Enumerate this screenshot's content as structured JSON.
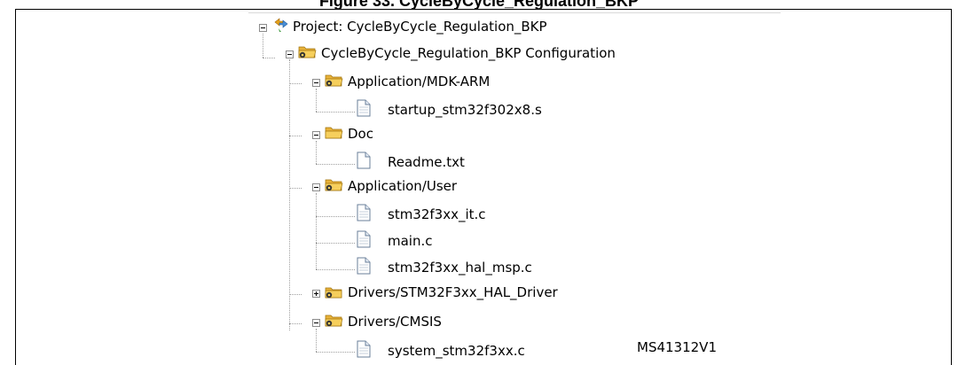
{
  "figure_title": "Figure 33. CycleByCycle_Regulation_BKP",
  "tree": [
    {
      "id": "project",
      "label": "Project: CycleByCycle_Regulation_BKP",
      "type": "project",
      "expanded": true
    },
    {
      "id": "config",
      "label": "CycleByCycle_Regulation_BKP Configuration",
      "type": "config-folder",
      "expanded": true
    },
    {
      "id": "app-mdk",
      "label": "Application/MDK-ARM",
      "type": "group-folder",
      "expanded": true
    },
    {
      "id": "startup",
      "label": "startup_stm32f302x8.s",
      "type": "file"
    },
    {
      "id": "doc",
      "label": "Doc",
      "type": "folder",
      "expanded": true
    },
    {
      "id": "readme",
      "label": "Readme.txt",
      "type": "file"
    },
    {
      "id": "app-user",
      "label": "Application/User",
      "type": "group-folder",
      "expanded": true
    },
    {
      "id": "it",
      "label": "stm32f3xx_it.c",
      "type": "file"
    },
    {
      "id": "main",
      "label": "main.c",
      "type": "file"
    },
    {
      "id": "msp",
      "label": "stm32f3xx_hal_msp.c",
      "type": "file"
    },
    {
      "id": "hal-driver",
      "label": "Drivers/STM32F3xx_HAL_Driver",
      "type": "group-folder",
      "expanded": false
    },
    {
      "id": "cmsis",
      "label": "Drivers/CMSIS",
      "type": "group-folder",
      "expanded": true
    },
    {
      "id": "system",
      "label": "system_stm32f3xx.c",
      "type": "file"
    }
  ],
  "watermark": "MS41312V1"
}
